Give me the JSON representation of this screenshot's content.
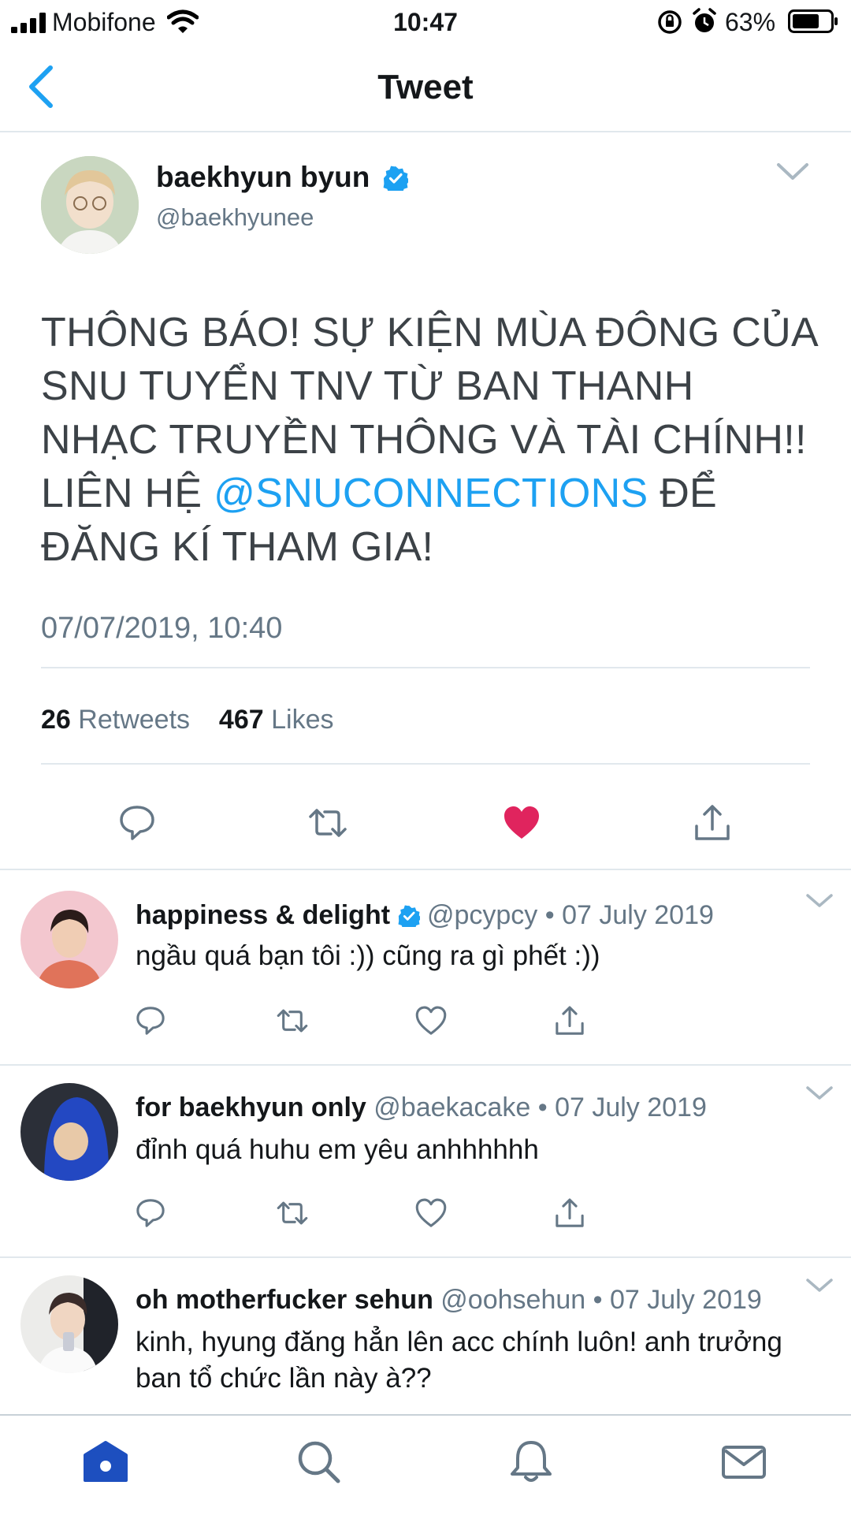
{
  "status_bar": {
    "carrier": "Mobifone",
    "time": "10:47",
    "battery": "63%"
  },
  "nav": {
    "title": "Tweet",
    "back_icon": "chevron-left-icon"
  },
  "tweet": {
    "author_name": "baekhyun byun",
    "author_handle": "@baekhyunee",
    "verified": true,
    "text_before_mention": "THÔNG BÁO! SỰ KIỆN MÙA ĐÔNG CỦA SNU TUYỂN TNV TỪ BAN THANH NHẠC TRUYỀN THÔNG VÀ TÀI CHÍNH!! LIÊN HỆ ",
    "mention": "@SNUCONNECTIONS",
    "text_after_mention": " ĐỂ ĐĂNG KÍ THAM GIA!",
    "timestamp": "07/07/2019, 10:40",
    "retweet_count": "26",
    "retweet_label": "Retweets",
    "like_count": "467",
    "like_label": "Likes",
    "liked": true
  },
  "replies": [
    {
      "name": "happiness & delight",
      "verified": true,
      "handle": "@pcypcy",
      "date": "• 07 July 2019",
      "text": "ngầu quá bạn tôi :)) cũng ra gì phết :))"
    },
    {
      "name": "for baekhyun only",
      "verified": false,
      "handle": "@baekacake",
      "date": "• 07 July 2019",
      "text": "đỉnh quá huhu em yêu anhhhhhh"
    },
    {
      "name": "oh motherfucker sehun",
      "verified": false,
      "handle": "@oohsehun",
      "date": "• 07 July 2019",
      "text": "kinh, hyung đăng hẳn lên acc chính luôn! anh trưởng ban tổ chức lần này à??"
    }
  ],
  "colors": {
    "accent": "#1da1f2",
    "like": "#e0245e",
    "secondary_text": "#657786"
  },
  "tabbar": {
    "items": [
      "home-icon",
      "search-icon",
      "notifications-icon",
      "messages-icon"
    ],
    "active": "home-icon"
  }
}
